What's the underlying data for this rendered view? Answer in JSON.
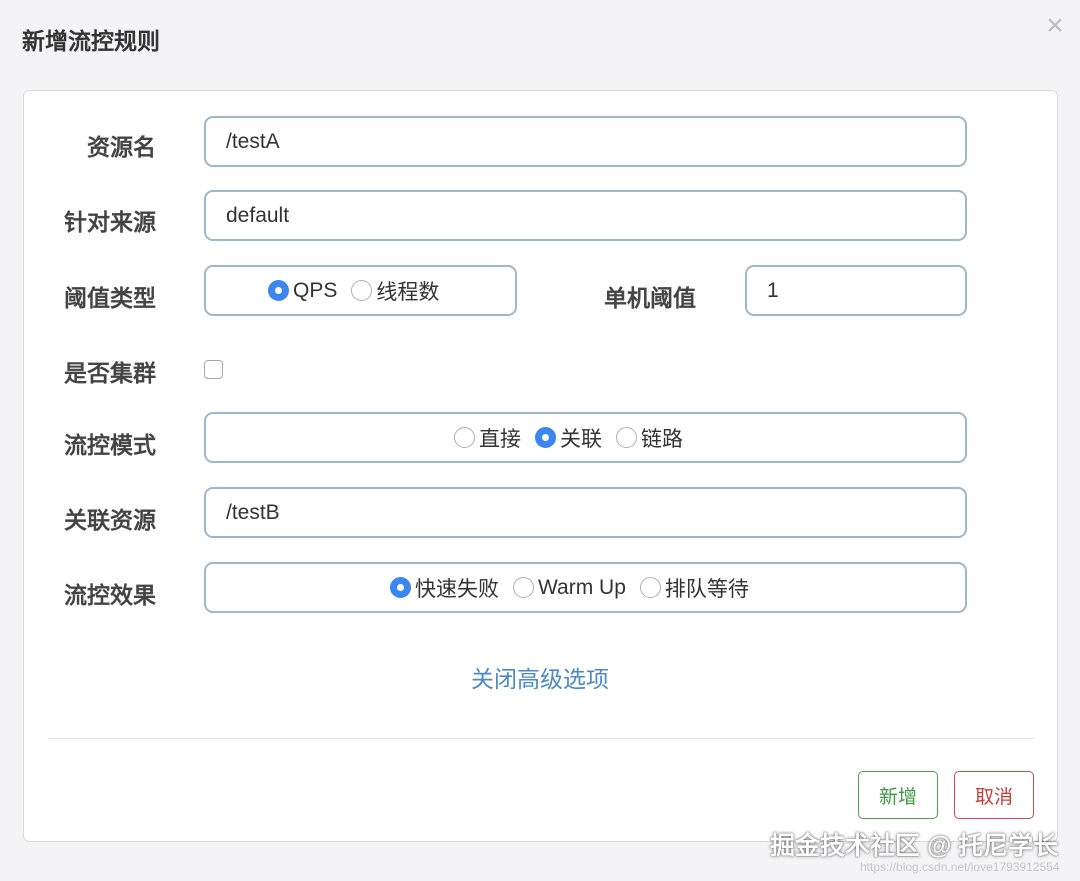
{
  "dialog": {
    "title": "新增流控规则",
    "close_icon": "×"
  },
  "form": {
    "resource_name": {
      "label": "资源名",
      "value": "/testA"
    },
    "limit_app": {
      "label": "针对来源",
      "value": "default"
    },
    "threshold_type": {
      "label": "阈值类型",
      "options": [
        {
          "label": "QPS",
          "selected": true
        },
        {
          "label": "线程数",
          "selected": false
        }
      ]
    },
    "single_threshold": {
      "label": "单机阈值",
      "value": "1"
    },
    "cluster_mode": {
      "label": "是否集群",
      "checked": false
    },
    "strategy": {
      "label": "流控模式",
      "options": [
        {
          "label": "直接",
          "selected": false
        },
        {
          "label": "关联",
          "selected": true
        },
        {
          "label": "链路",
          "selected": false
        }
      ]
    },
    "ref_resource": {
      "label": "关联资源",
      "value": "/testB"
    },
    "control_behavior": {
      "label": "流控效果",
      "options": [
        {
          "label": "快速失败",
          "selected": true
        },
        {
          "label": "Warm Up",
          "selected": false
        },
        {
          "label": "排队等待",
          "selected": false
        }
      ]
    }
  },
  "advanced_toggle": "关闭高级选项",
  "buttons": {
    "add": "新增",
    "cancel": "取消"
  },
  "watermark": {
    "brand": "掘金技术社区 @ 托尼学长",
    "url": "https://blog.csdn.net/love1793912554"
  },
  "colors": {
    "radio_selected": "#3b86f0",
    "input_border": "#9fb7cc",
    "link": "#4a8ac8",
    "add_button": "#3d9a43",
    "cancel_button": "#c93c3c"
  }
}
